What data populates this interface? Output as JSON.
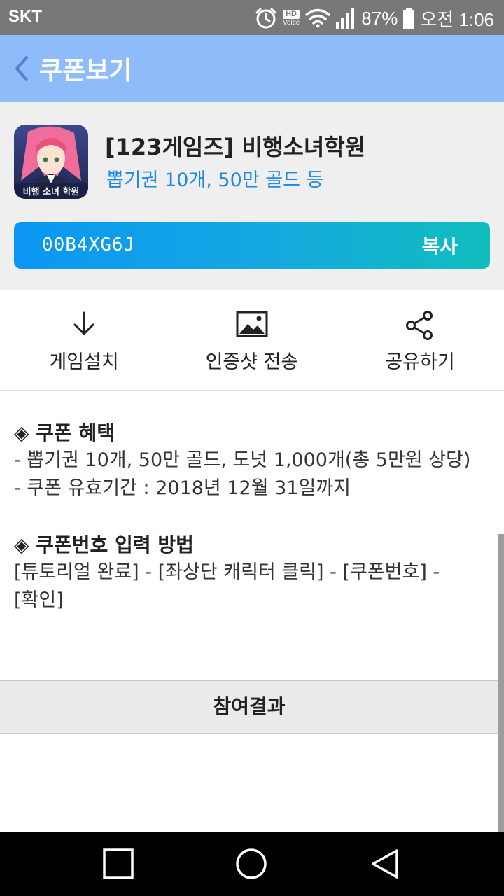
{
  "status_bar": {
    "carrier": "SKT",
    "hd": "HD",
    "voice": "Voice",
    "battery": "87%",
    "time": "오전 1:06"
  },
  "app_bar": {
    "title": "쿠폰보기"
  },
  "coupon": {
    "game_title": "[123게임즈] 비행소녀학원",
    "subtitle": "뽑기권 10개, 50만 골드 등",
    "icon_caption": "비행 소녀 학원",
    "code": "00B4XG6J",
    "copy_label": "복사"
  },
  "actions": [
    {
      "label": "게임설치",
      "icon": "download-icon"
    },
    {
      "label": "인증샷 전송",
      "icon": "image-icon"
    },
    {
      "label": "공유하기",
      "icon": "share-icon"
    }
  ],
  "details": {
    "benefits_heading": "◈ 쿠폰 혜택",
    "benefits": [
      "- 뽑기권 10개, 50만 골드, 도넛 1,000개(총 5만원 상당)",
      "- 쿠폰 유효기간 : 2018년 12월 31일까지"
    ],
    "howto_heading": "◈ 쿠폰번호 입력 방법",
    "howto": [
      "[튜토리얼 완료] - [좌상단 캐릭터 클릭] - [쿠폰번호] -",
      "[확인]"
    ]
  },
  "results_label": "참여결과",
  "colors": {
    "app_bar": "#8ebcfb",
    "accent": "#1e88e5",
    "status_bar": "#787878"
  }
}
